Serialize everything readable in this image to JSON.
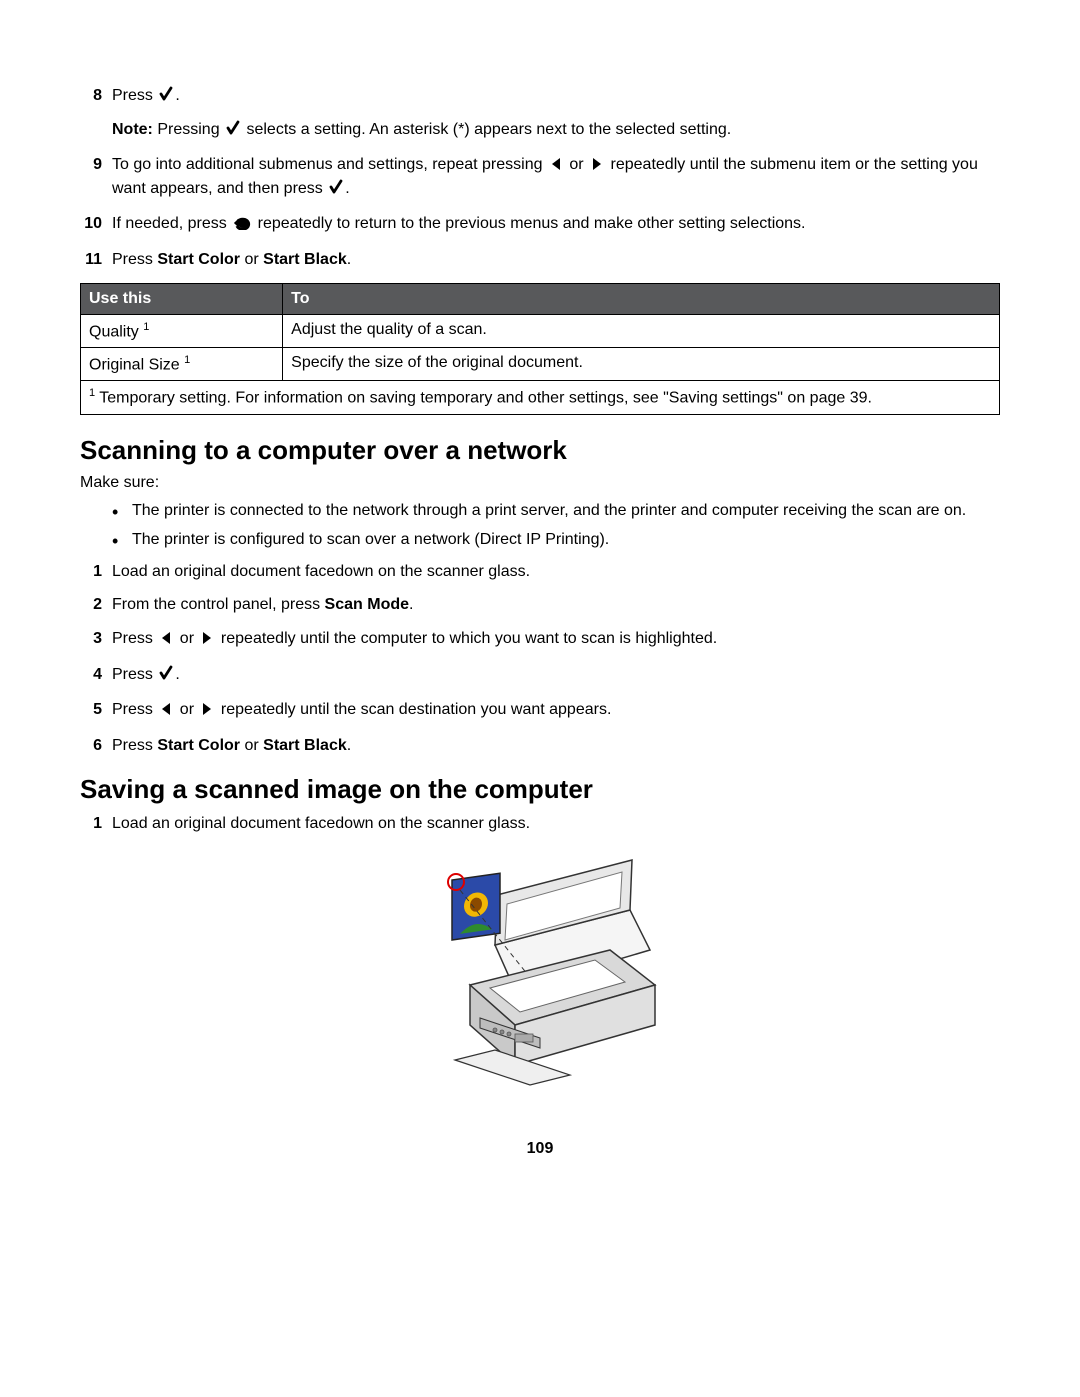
{
  "steps_a": {
    "s8": {
      "num": "8",
      "text_a": "Press ",
      "text_b": "."
    },
    "s8_note": {
      "label": "Note:",
      "a": " Pressing ",
      "b": " selects a setting. An asterisk (*) appears next to the selected setting."
    },
    "s9": {
      "num": "9",
      "a": "To go into additional submenus and settings, repeat pressing ",
      "b": " or ",
      "c": " repeatedly until the submenu item or the setting you want appears, and then press ",
      "d": "."
    },
    "s10": {
      "num": "10",
      "a": "If needed, press ",
      "b": " repeatedly to return to the previous menus and make other setting selections."
    },
    "s11": {
      "num": "11",
      "a": "Press ",
      "b": "Start Color",
      "c": " or ",
      "d": "Start Black",
      "e": "."
    }
  },
  "table": {
    "h1": "Use this",
    "h2": "To",
    "r1c1": "Quality ",
    "r1c2": "Adjust the quality of a scan.",
    "r2c1": "Original Size ",
    "r2c2": "Specify the size of the original document.",
    "foot_sup": "1",
    "foot": " Temporary setting. For information on saving temporary and other settings, see \"Saving settings\" on page 39.",
    "sup1": "1",
    "sup2": "1"
  },
  "section_b": {
    "title": "Scanning to a computer over a network",
    "intro": "Make sure:",
    "bul1": "The printer is connected to the network through a print server, and the printer and computer receiving the scan are on.",
    "bul2": "The printer is configured to scan over a network (Direct IP Printing).",
    "s1": {
      "num": "1",
      "text": "Load an original document facedown on the scanner glass."
    },
    "s2": {
      "num": "2",
      "a": "From the control panel, press ",
      "b": "Scan Mode",
      "c": "."
    },
    "s3": {
      "num": "3",
      "a": "Press ",
      "b": " or ",
      "c": " repeatedly until the computer to which you want to scan is highlighted."
    },
    "s4": {
      "num": "4",
      "a": "Press ",
      "b": "."
    },
    "s5": {
      "num": "5",
      "a": "Press ",
      "b": " or ",
      "c": " repeatedly until the scan destination you want appears."
    },
    "s6": {
      "num": "6",
      "a": "Press ",
      "b": "Start Color",
      "c": " or ",
      "d": "Start Black",
      "e": "."
    }
  },
  "section_c": {
    "title": "Saving a scanned image on the computer",
    "s1": {
      "num": "1",
      "text": "Load an original document facedown on the scanner glass."
    }
  },
  "pagenum": "109"
}
